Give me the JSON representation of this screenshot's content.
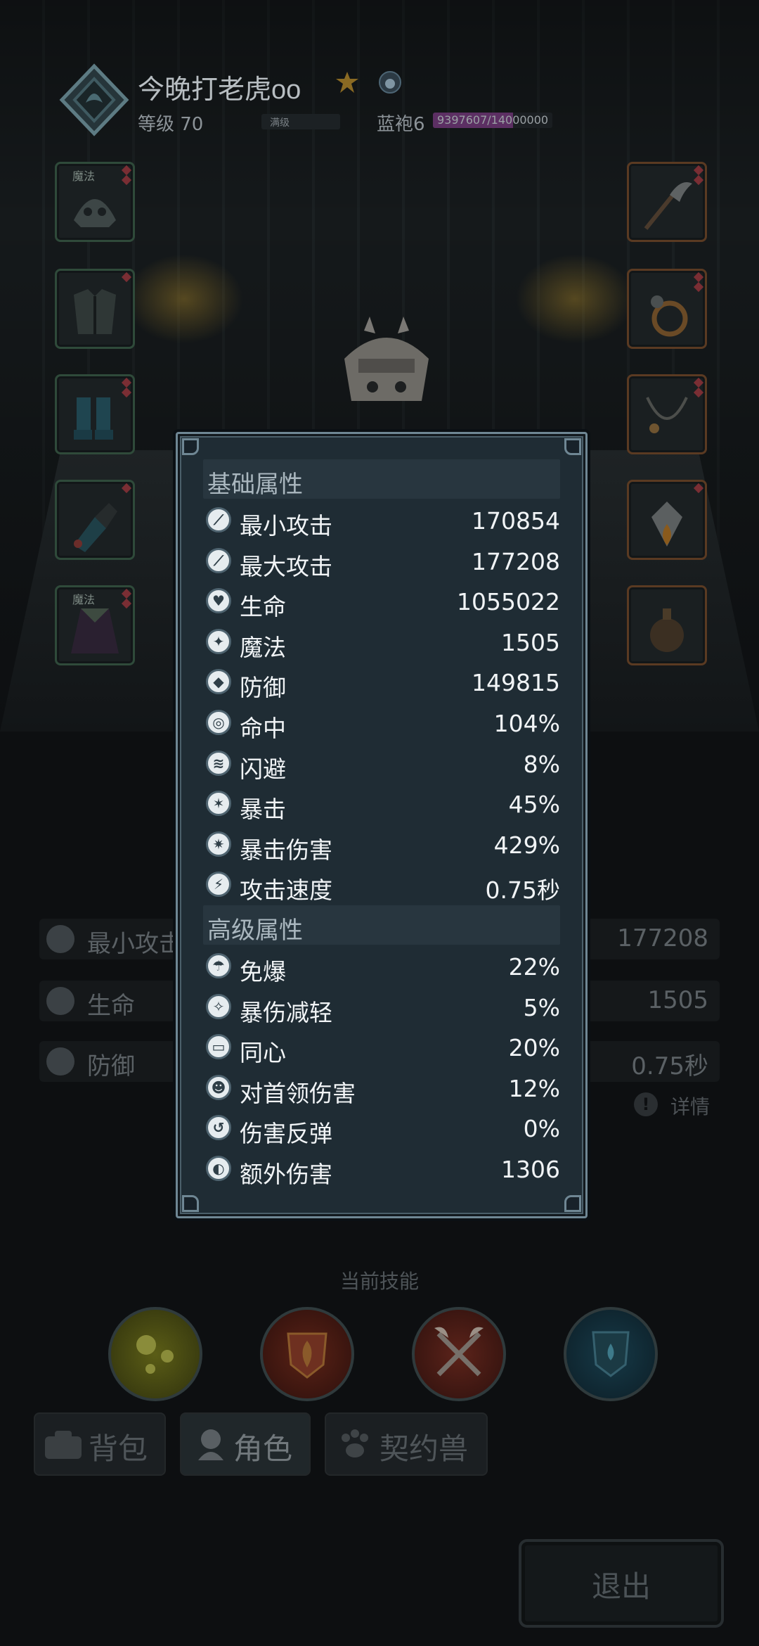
{
  "header": {
    "player_name": "今晚打老虎oo",
    "level_label": "等级 70",
    "level_status": "满级",
    "rank_label": "蓝袍6",
    "xp_text": "9397607/14000000",
    "xp_current": 9397607,
    "xp_max": 14000000
  },
  "equipment": {
    "left_slots": [
      {
        "tag": "魔法",
        "icon": "helmet-icon"
      },
      {
        "tag": "",
        "icon": "armor-icon"
      },
      {
        "tag": "",
        "icon": "boots-icon"
      },
      {
        "tag": "",
        "icon": "gauntlet-icon"
      },
      {
        "tag": "魔法",
        "icon": "cape-icon"
      }
    ],
    "right_slots": [
      {
        "icon": "weapon-icon"
      },
      {
        "icon": "ring-icon"
      },
      {
        "icon": "necklace-icon"
      },
      {
        "icon": "fire-gem-icon"
      },
      {
        "icon": "potion-icon"
      }
    ]
  },
  "background_stats": {
    "rows": [
      {
        "label": "最小攻击",
        "value": "177208"
      },
      {
        "label": "生命",
        "value": "1505"
      },
      {
        "label": "防御",
        "value": "0.75秒"
      }
    ],
    "detail_label": "详情",
    "detail_icon": "!"
  },
  "skills": {
    "title": "当前技能",
    "items": [
      {
        "icon": "bubbles-skill-icon",
        "color": "#7c7f1e"
      },
      {
        "icon": "flame-shield-skill-icon",
        "color": "#7a2a1c"
      },
      {
        "icon": "crossed-axes-skill-icon",
        "color": "#7e2b22"
      },
      {
        "icon": "water-shield-skill-icon",
        "color": "#1f4a5c"
      }
    ]
  },
  "tabs": [
    {
      "label": "背包",
      "icon": "bag-icon"
    },
    {
      "label": "角色",
      "icon": "character-icon"
    },
    {
      "label": "契约兽",
      "icon": "paw-icon"
    }
  ],
  "exit_label": "退出",
  "modal": {
    "basic_title": "基础属性",
    "basic": [
      {
        "label": "最小攻击",
        "value": "170854",
        "icon": "sword-icon"
      },
      {
        "label": "最大攻击",
        "value": "177208",
        "icon": "sword-icon"
      },
      {
        "label": "生命",
        "value": "1055022",
        "icon": "heart-icon"
      },
      {
        "label": "魔法",
        "value": "1505",
        "icon": "magic-icon"
      },
      {
        "label": "防御",
        "value": "149815",
        "icon": "shield-icon"
      },
      {
        "label": "命中",
        "value": "104%",
        "icon": "target-icon"
      },
      {
        "label": "闪避",
        "value": "8%",
        "icon": "dodge-icon"
      },
      {
        "label": "暴击",
        "value": "45%",
        "icon": "crit-icon"
      },
      {
        "label": "暴击伤害",
        "value": "429%",
        "icon": "crit-damage-icon"
      },
      {
        "label": "攻击速度",
        "value": "0.75秒",
        "icon": "attack-speed-icon"
      }
    ],
    "advanced_title": "高级属性",
    "advanced": [
      {
        "label": "免爆",
        "value": "22%",
        "icon": "crit-immune-icon"
      },
      {
        "label": "暴伤减轻",
        "value": "5%",
        "icon": "crit-reduce-icon"
      },
      {
        "label": "同心",
        "value": "20%",
        "icon": "unity-icon"
      },
      {
        "label": "对首领伤害",
        "value": "12%",
        "icon": "boss-damage-icon"
      },
      {
        "label": "伤害反弹",
        "value": "0%",
        "icon": "reflect-icon"
      },
      {
        "label": "额外伤害",
        "value": "1306",
        "icon": "extra-damage-icon"
      }
    ]
  }
}
